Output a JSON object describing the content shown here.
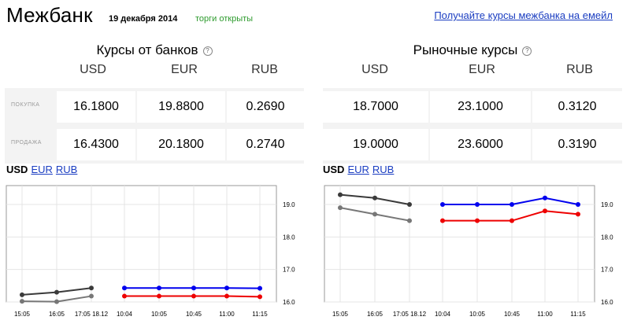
{
  "header": {
    "title": "Межбанк",
    "date": "19 декабря 2014",
    "status": "торги открыты",
    "email_link": "Получайте курсы межбанка на емейл"
  },
  "bank_rates": {
    "title": "Курсы от банков",
    "help": "?",
    "columns": [
      "USD",
      "EUR",
      "RUB"
    ],
    "rows": [
      {
        "label": "ПОКУПКА",
        "values": [
          "16.1800",
          "19.8800",
          "0.2690"
        ]
      },
      {
        "label": "ПРОДАЖА",
        "values": [
          "16.4300",
          "20.1800",
          "0.2740"
        ]
      }
    ]
  },
  "market_rates": {
    "title": "Рыночные курсы",
    "help": "?",
    "columns": [
      "USD",
      "EUR",
      "RUB"
    ],
    "rows": [
      {
        "label": "",
        "values": [
          "18.7000",
          "23.1000",
          "0.3120"
        ]
      },
      {
        "label": "",
        "values": [
          "19.0000",
          "23.6000",
          "0.3190"
        ]
      }
    ]
  },
  "tabs": {
    "current": "USD",
    "links": [
      "EUR",
      "RUB"
    ]
  },
  "chart_data": [
    {
      "type": "line",
      "x": [
        "15:05",
        "16:05",
        "17:05 18.12",
        "10:04",
        "10:05",
        "10:45",
        "11:00",
        "11:15"
      ],
      "ylim": [
        16.0,
        19.0
      ],
      "yticks": [
        "16.0",
        "17.0",
        "18.0",
        "19.0"
      ],
      "grid": true,
      "series": [
        {
          "color": "#3a3a3a",
          "values": [
            16.22,
            16.3,
            16.43,
            null,
            null,
            null,
            null,
            null
          ]
        },
        {
          "color": "#777777",
          "values": [
            16.02,
            16.01,
            16.18,
            null,
            null,
            null,
            null,
            null
          ]
        },
        {
          "color": "#0000ee",
          "values": [
            null,
            null,
            null,
            16.43,
            16.43,
            16.43,
            16.43,
            16.42
          ]
        },
        {
          "color": "#ee0000",
          "values": [
            null,
            null,
            null,
            16.18,
            16.18,
            16.18,
            16.18,
            16.16
          ]
        }
      ]
    },
    {
      "type": "line",
      "x": [
        "15:05",
        "16:05",
        "17:05 18.12",
        "10:04",
        "10:05",
        "10:45",
        "11:00",
        "11:15"
      ],
      "ylim": [
        16.0,
        19.0
      ],
      "yticks": [
        "16.0",
        "17.0",
        "18.0",
        "19.0"
      ],
      "grid": true,
      "series": [
        {
          "color": "#3a3a3a",
          "values": [
            19.3,
            19.2,
            19.0,
            null,
            null,
            null,
            null,
            null
          ]
        },
        {
          "color": "#777777",
          "values": [
            18.9,
            18.7,
            18.5,
            null,
            null,
            null,
            null,
            null
          ]
        },
        {
          "color": "#0000ee",
          "values": [
            null,
            null,
            null,
            19.0,
            19.0,
            19.0,
            19.2,
            19.0
          ]
        },
        {
          "color": "#ee0000",
          "values": [
            null,
            null,
            null,
            18.5,
            18.5,
            18.5,
            18.8,
            18.7
          ]
        }
      ]
    }
  ]
}
